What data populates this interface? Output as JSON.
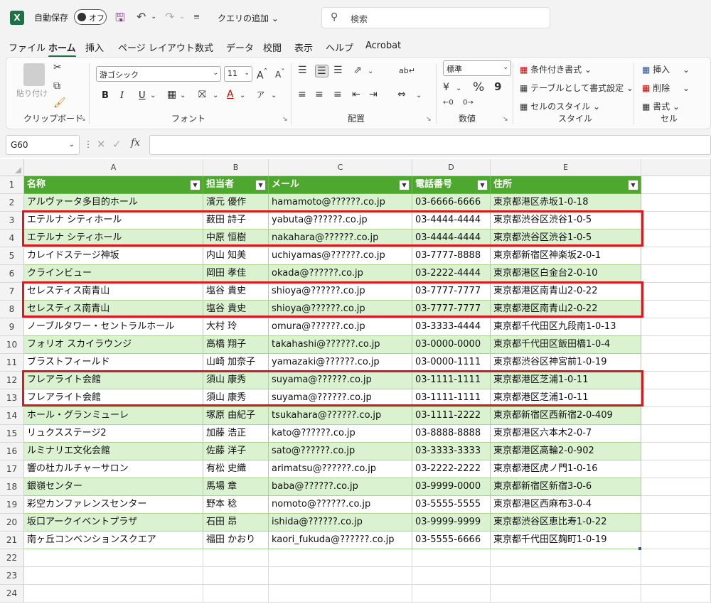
{
  "titlebar": {
    "app_icon": "X",
    "autosave_label": "自動保存",
    "autosave_state": "オフ",
    "query_add": "クエリの追加",
    "search_placeholder": "検索"
  },
  "tabs": [
    "ファイル",
    "ホーム",
    "挿入",
    "ページ レイアウト",
    "数式",
    "データ",
    "校閲",
    "表示",
    "ヘルプ",
    "Acrobat"
  ],
  "ribbon": {
    "clipboard": {
      "label": "クリップボード",
      "paste": "貼り付け"
    },
    "font": {
      "label": "フォント",
      "family": "游ゴシック",
      "size": "11",
      "grow": "A^",
      "shrink": "A˅",
      "bold": "B",
      "italic": "I",
      "underline": "U"
    },
    "alignment": {
      "label": "配置"
    },
    "number": {
      "label": "数値",
      "format": "標準",
      "percent": "%",
      "comma": "9"
    },
    "styles": {
      "label": "スタイル",
      "conditional": "条件付き書式",
      "table_format": "テーブルとして書式設定",
      "cell_styles": "セルのスタイル"
    },
    "cells": {
      "label": "セル",
      "insert": "挿入",
      "delete": "削除",
      "format": "書式"
    }
  },
  "formula_bar": {
    "name_box": "G60",
    "fx": "fx",
    "value": ""
  },
  "columns": [
    "A",
    "B",
    "C",
    "D",
    "E"
  ],
  "table": {
    "headers": [
      "名称",
      "担当者",
      "メール",
      "電話番号",
      "住所"
    ],
    "rows": [
      [
        "アルヴァータ多目的ホール",
        "濱元 優作",
        "hamamoto@??????.co.jp",
        "03-6666-6666",
        "東京都港区赤坂1-0-18"
      ],
      [
        "エテルナ シティホール",
        "薮田 詩子",
        "yabuta@??????.co.jp",
        "03-4444-4444",
        "東京都渋谷区渋谷1-0-5"
      ],
      [
        "エテルナ シティホール",
        "中原 恒樹",
        "nakahara@??????.co.jp",
        "03-4444-4444",
        "東京都渋谷区渋谷1-0-5"
      ],
      [
        "カレイドステージ神坂",
        "内山 知美",
        "uchiyamas@??????.co.jp",
        "03-7777-8888",
        "東京都新宿区神楽坂2-0-1"
      ],
      [
        "クラインビュー",
        "岡田 孝佳",
        "okada@??????.co.jp",
        "03-2222-4444",
        "東京都港区白金台2-0-10"
      ],
      [
        "セレスティス南青山",
        "塩谷 貴史",
        "shioya@??????.co.jp",
        "03-7777-7777",
        "東京都港区南青山2-0-22"
      ],
      [
        "セレスティス南青山",
        "塩谷 貴史",
        "shioya@??????.co.jp",
        "03-7777-7777",
        "東京都港区南青山2-0-22"
      ],
      [
        "ノーブルタワー・セントラルホール",
        "大村 玲",
        "omura@??????.co.jp",
        "03-3333-4444",
        "東京都千代田区九段南1-0-13"
      ],
      [
        "フォリオ スカイラウンジ",
        "高橋 翔子",
        "takahashi@??????.co.jp",
        "03-0000-0000",
        "東京都千代田区飯田橋1-0-4"
      ],
      [
        "ブラストフィールド",
        "山崎 加奈子",
        "yamazaki@??????.co.jp",
        "03-0000-1111",
        "東京都渋谷区神宮前1-0-19"
      ],
      [
        "フレアライト会館",
        "須山 康秀",
        "suyama@??????.co.jp",
        "03-1111-1111",
        "東京都港区芝浦1-0-11"
      ],
      [
        "フレアライト会館",
        "須山 康秀",
        "suyama@??????.co.jp",
        "03-1111-1111",
        "東京都港区芝浦1-0-11"
      ],
      [
        "ホール・グランミューレ",
        "塚原 由紀子",
        "tsukahara@??????.co.jp",
        "03-1111-2222",
        "東京都新宿区西新宿2-0-409"
      ],
      [
        "リュクスステージ2",
        "加藤 浩正",
        "kato@??????.co.jp",
        "03-8888-8888",
        "東京都港区六本木2-0-7"
      ],
      [
        "ルミナリエ文化会館",
        "佐藤 洋子",
        "sato@??????.co.jp",
        "03-3333-3333",
        "東京都港区高輪2-0-902"
      ],
      [
        "響の杜カルチャーサロン",
        "有松 史織",
        "arimatsu@??????.co.jp",
        "03-2222-2222",
        "東京都港区虎ノ門1-0-16"
      ],
      [
        "銀嶺センター",
        "馬場 章",
        "baba@??????.co.jp",
        "03-9999-0000",
        "東京都新宿区新宿3-0-6"
      ],
      [
        "彩空カンファレンスセンター",
        "野本 稔",
        "nomoto@??????.co.jp",
        "03-5555-5555",
        "東京都港区西麻布3-0-4"
      ],
      [
        "坂口アークイベントプラザ",
        "石田 昂",
        "ishida@??????.co.jp",
        "03-9999-9999",
        "東京都渋谷区恵比寿1-0-22"
      ],
      [
        "南ヶ丘コンベンションスクエア",
        "福田 かおり",
        "kaori_fukuda@??????.co.jp",
        "03-5555-6666",
        "東京都千代田区麹町1-0-19"
      ]
    ]
  },
  "row_numbers": [
    "1",
    "2",
    "3",
    "4",
    "5",
    "6",
    "7",
    "8",
    "9",
    "10",
    "11",
    "12",
    "13",
    "14",
    "15",
    "16",
    "17",
    "18",
    "19",
    "20",
    "21",
    "22",
    "23",
    "24"
  ],
  "highlight_color": "#d71920",
  "header_color": "#4ea72e",
  "band_color": "#daf2d0"
}
